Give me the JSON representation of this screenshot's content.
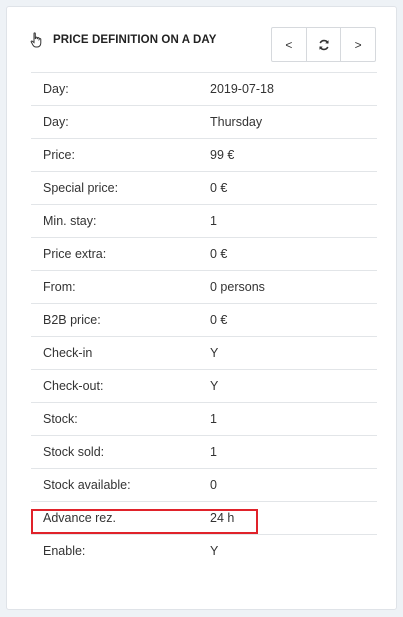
{
  "header": {
    "title": "PRICE DEFINITION ON A DAY",
    "icon": "hand-pointer-icon"
  },
  "toolbar": {
    "prev_label": "<",
    "refresh_icon": "refresh-icon",
    "next_label": ">"
  },
  "rows": [
    {
      "label": "Day:",
      "value": "2019-07-18"
    },
    {
      "label": "Day:",
      "value": "Thursday"
    },
    {
      "label": "Price:",
      "value": "99 €"
    },
    {
      "label": "Special price:",
      "value": "0 €"
    },
    {
      "label": "Min. stay:",
      "value": "1"
    },
    {
      "label": "Price extra:",
      "value": "0 €"
    },
    {
      "label": "From:",
      "value": "0 persons"
    },
    {
      "label": "B2B price:",
      "value": "0 €"
    },
    {
      "label": "Check-in",
      "value": "Y"
    },
    {
      "label": "Check-out:",
      "value": "Y"
    },
    {
      "label": "Stock:",
      "value": "1"
    },
    {
      "label": "Stock sold:",
      "value": "1"
    },
    {
      "label": "Stock available:",
      "value": "0"
    },
    {
      "label": "Advance rez.",
      "value": "24 h"
    },
    {
      "label": "Enable:",
      "value": "Y"
    }
  ],
  "colors": {
    "highlight": "#e0222a",
    "background": "#eef2f6"
  }
}
